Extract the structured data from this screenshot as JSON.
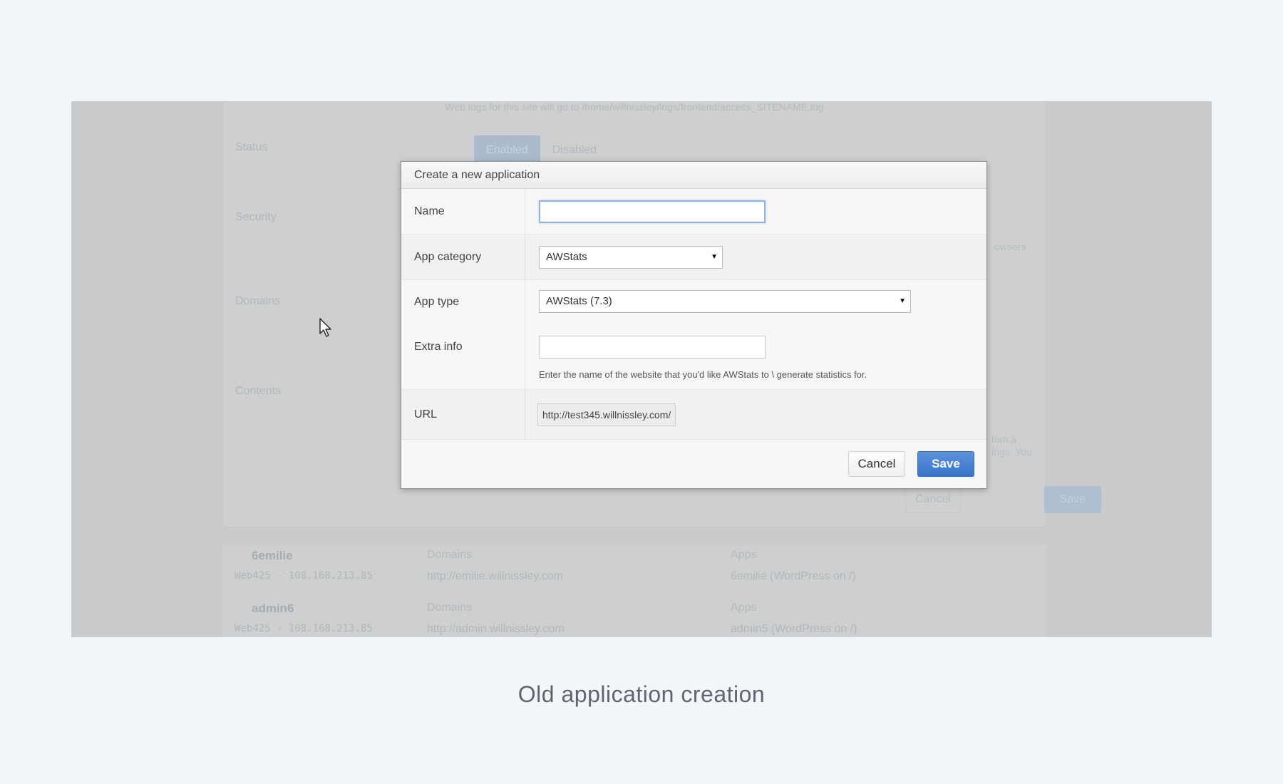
{
  "background": {
    "log_note": "Web logs for this site will go to /home/willnissley/logs/frontend/access_SITENAME.log",
    "labels": [
      "Status",
      "Security",
      "Domains",
      "Contents"
    ],
    "status_toggle": {
      "enabled": "Enabled",
      "disabled": "Disabled"
    },
    "side_text": [
      "owsers",
      "tom a",
      "ings. You"
    ],
    "cancel_label": "Cancel",
    "save_label": "Save",
    "sites": [
      {
        "user": "6emilie",
        "server": "Web425 - 108.168.213.85",
        "domains_header": "Domains",
        "domain": "http://emilie.willnissley.com",
        "apps_header": "Apps",
        "app": "6emilie (WordPress on /)"
      },
      {
        "user": "admin6",
        "server": "Web425 - 108.168.213.85",
        "domains_header": "Domains",
        "domain": "http://admin.willnissley.com",
        "apps_header": "Apps",
        "app": "admin5 (WordPress on /)"
      }
    ]
  },
  "dialog": {
    "title": "Create a new application",
    "name_label": "Name",
    "name_value": "",
    "category_label": "App category",
    "category_value": "AWStats",
    "type_label": "App type",
    "type_value": "AWStats (7.3)",
    "extra_label": "Extra info",
    "extra_value": "",
    "extra_help": "Enter the name of the website that you'd like AWStats to \\ generate statistics for.",
    "url_label": "URL",
    "url_value": "http://test345.willnissley.com/",
    "cancel_label": "Cancel",
    "save_label": "Save"
  },
  "caption": "Old application creation",
  "icons": {
    "cursor": "arrow-cursor-icon",
    "dropdown": "caret-down-icon"
  },
  "colors": {
    "accent": "#3b75c9",
    "page_bg": "#f3f6f9"
  }
}
